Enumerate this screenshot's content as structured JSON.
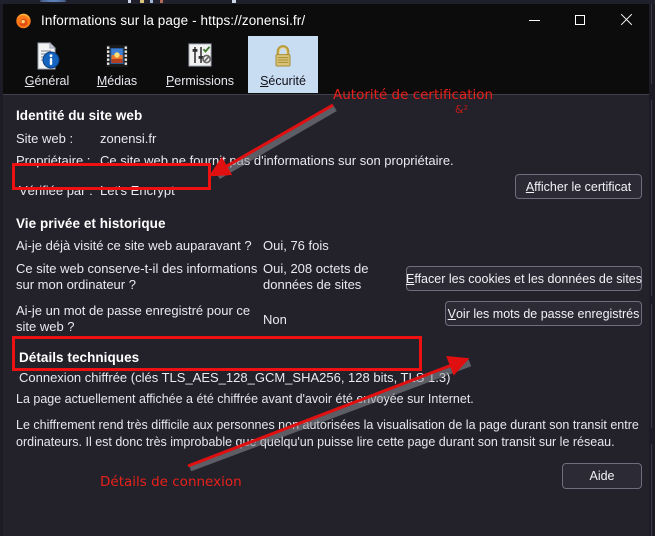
{
  "window": {
    "title": "Informations sur la page - https://zonensi.fr/",
    "app_icon": "firefox-icon",
    "minimize_label": "—",
    "maximize_label": "□",
    "close_label": "✕"
  },
  "tabs": [
    {
      "id": "general",
      "label": "Général",
      "accesskey": "G",
      "icon": "document-info-icon",
      "selected": false
    },
    {
      "id": "media",
      "label": "Médias",
      "accesskey": "M",
      "icon": "film-image-icon",
      "selected": false
    },
    {
      "id": "permissions",
      "label": "Permissions",
      "accesskey": "P",
      "icon": "sliders-icon",
      "selected": false
    },
    {
      "id": "security",
      "label": "Sécurité",
      "accesskey": "S",
      "icon": "padlock-icon",
      "selected": true
    }
  ],
  "identity": {
    "heading": "Identité du site web",
    "rows": [
      {
        "label": "Site web :",
        "value": "zonensi.fr"
      },
      {
        "label": "Propriétaire :",
        "value": "Ce site web ne fournit pas d'informations sur son propriétaire."
      },
      {
        "label": "Vérifiée par :",
        "value": "Let's Encrypt"
      }
    ],
    "view_cert_button": "Afficher le certificat",
    "view_cert_accesskey": "A"
  },
  "privacy": {
    "heading": "Vie privée et historique",
    "rows": [
      {
        "label": "Ai-je déjà visité ce site web auparavant ?",
        "value": "Oui, 76 fois"
      },
      {
        "label": "Ce site web conserve-t-il des informations sur mon ordinateur ?",
        "value": "Oui, 208 octets de données de sites"
      },
      {
        "label": "Ai-je un mot de passe enregistré pour ce site web ?",
        "value": "Non"
      }
    ],
    "clear_cookies_button": "Effacer les cookies et les données de sites",
    "clear_cookies_accesskey": "E",
    "view_passwords_button": "Voir les mots de passe enregistrés",
    "view_passwords_accesskey": "V"
  },
  "technical": {
    "heading": "Détails techniques",
    "connection": "Connexion chiffrée (clés TLS_AES_128_GCM_SHA256, 128 bits, TLS 1.3)",
    "paragraph1": "La page actuellement affichée a été chiffrée avant d'avoir été envoyée sur Internet.",
    "paragraph2": "Le chiffrement rend très difficile aux personnes non autorisées la visualisation de la page durant son transit entre ordinateurs. Il est donc très improbable que quelqu'un puisse lire cette page durant son transit sur le réseau."
  },
  "footer": {
    "help_button": "Aide"
  },
  "annotations": [
    {
      "id": "ca",
      "text": "Autorité de certification"
    },
    {
      "id": "stray",
      "text": "&²"
    },
    {
      "id": "conn",
      "text": "Détails de connexion"
    }
  ],
  "colors": {
    "window_bg": "#23222b",
    "titlebar_bg": "#0c0c0c",
    "selected_tab_bg": "#c8dcf2",
    "annotation_red": "#ee1111",
    "text": "#ededf2",
    "button_border": "#6e6e7c"
  }
}
